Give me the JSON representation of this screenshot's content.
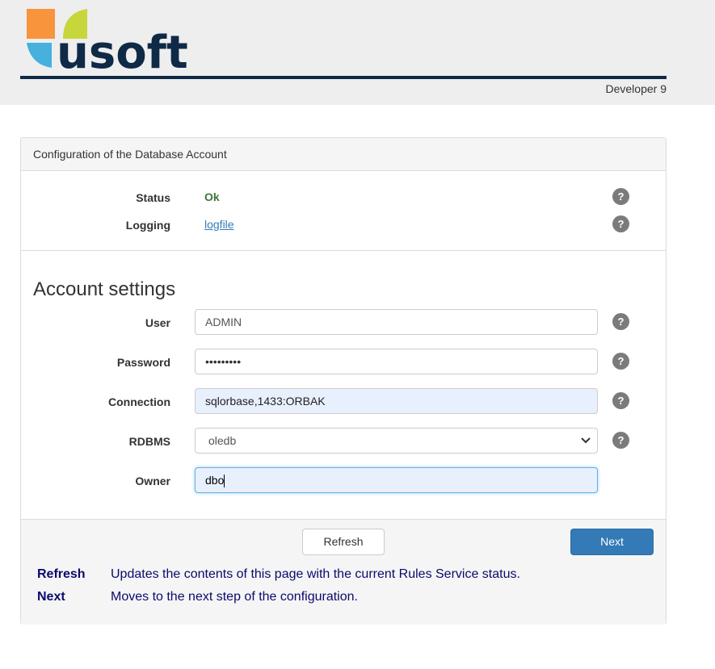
{
  "header": {
    "logo_text": "usoft",
    "version": "Developer 9",
    "colors": {
      "orange": "#f7943c",
      "green": "#c7d63a",
      "blue": "#45b1dc",
      "navy": "#0f2a46"
    }
  },
  "panel": {
    "title": "Configuration of the Database Account",
    "status": {
      "label": "Status",
      "value": "Ok",
      "color": "#3c763d"
    },
    "logging": {
      "label": "Logging",
      "value": "logfile"
    },
    "help_glyph": "?"
  },
  "account": {
    "title": "Account settings",
    "user": {
      "label": "User",
      "value": "ADMIN"
    },
    "password": {
      "label": "Password",
      "value": "•••••••••"
    },
    "connection": {
      "label": "Connection",
      "value": "sqlorbase,1433:ORBAK"
    },
    "rdbms": {
      "label": "RDBMS",
      "value": "oledb"
    },
    "owner": {
      "label": "Owner",
      "value": "dbo"
    }
  },
  "footer": {
    "refresh_label": "Refresh",
    "next_label": "Next",
    "help": [
      {
        "term": "Refresh",
        "desc": "Updates the contents of this page with the current Rules Service status."
      },
      {
        "term": "Next",
        "desc": "Moves to the next step of the configuration."
      }
    ]
  }
}
